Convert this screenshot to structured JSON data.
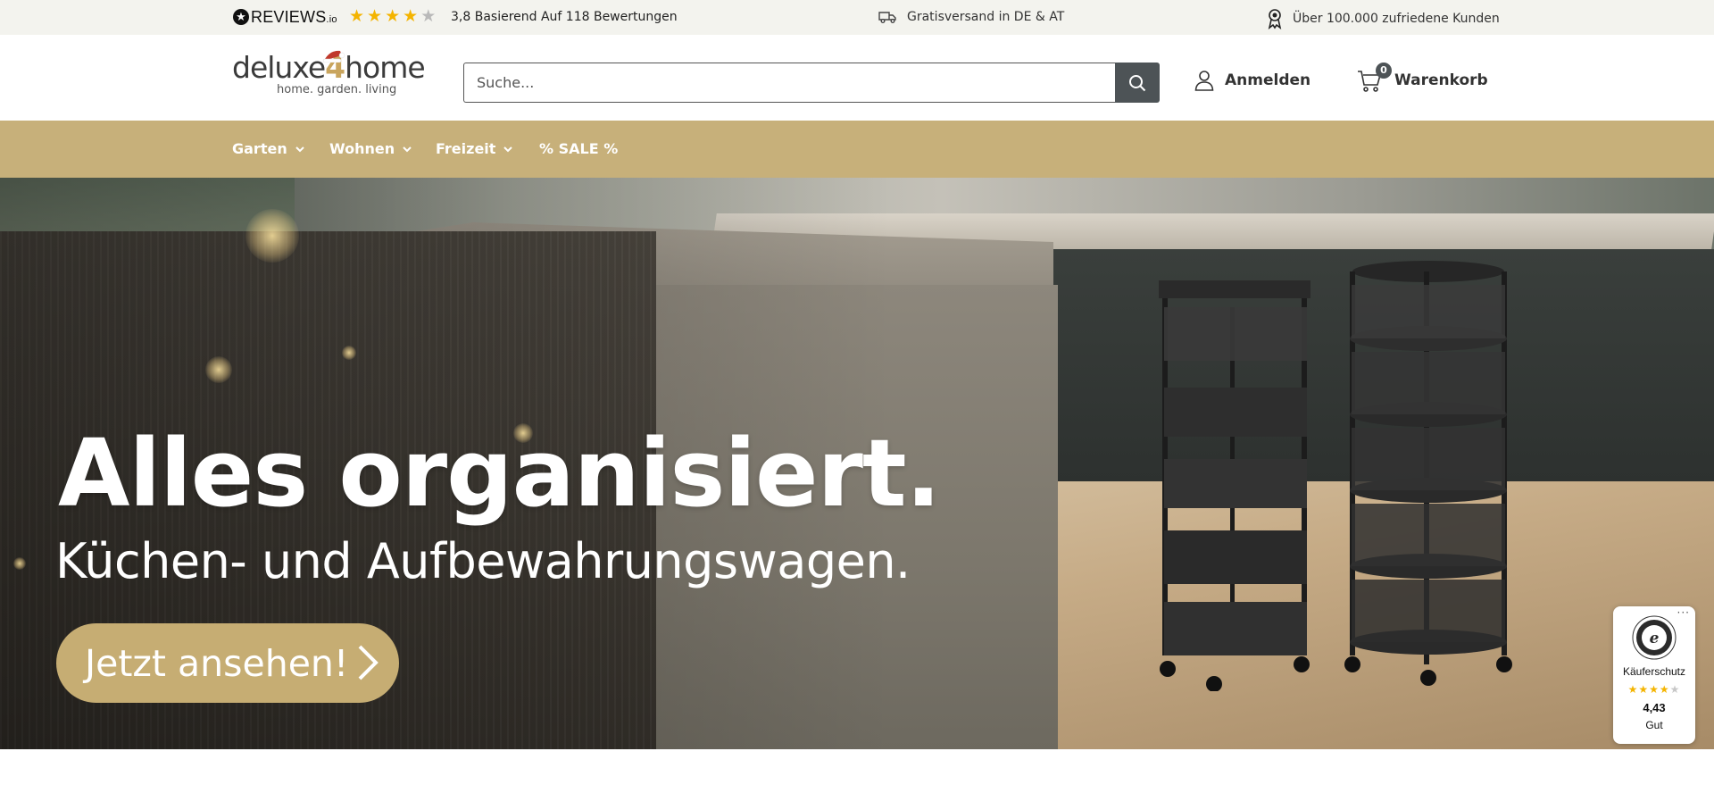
{
  "topbar": {
    "reviews_brand": "REVIEWS",
    "reviews_brand_suffix": "io",
    "rating_stars": 3.8,
    "rating_text": "3,8 Basierend Auf 118 Bewertungen",
    "usp_shipping": "Gratisversand in DE & AT",
    "usp_customers": "Über 100.000 zufriedene Kunden"
  },
  "header": {
    "logo_main_a": "deluxe",
    "logo_main_four": "4",
    "logo_main_b": "home",
    "logo_tagline": "home. garden. living",
    "search_placeholder": "Suche...",
    "account_label": "Anmelden",
    "cart_count": "0",
    "cart_label": "Warenkorb"
  },
  "nav": {
    "items": [
      {
        "label": "Garten"
      },
      {
        "label": "Wohnen"
      },
      {
        "label": "Freizeit"
      },
      {
        "label": "% SALE %"
      }
    ]
  },
  "hero": {
    "title": "Alles organisiert.",
    "subtitle": "Küchen- und Aufbewahrungswagen.",
    "cta_label": "Jetzt ansehen!"
  },
  "trust_widget": {
    "label": "Käuferschutz",
    "score": "4,43",
    "grade": "Gut",
    "stars": 4.43,
    "dots": "···"
  },
  "colors": {
    "nav_bg": "#c7b07a",
    "cta_bg": "#c6ad73",
    "search_button": "#4d5356",
    "star": "#f4b400"
  }
}
